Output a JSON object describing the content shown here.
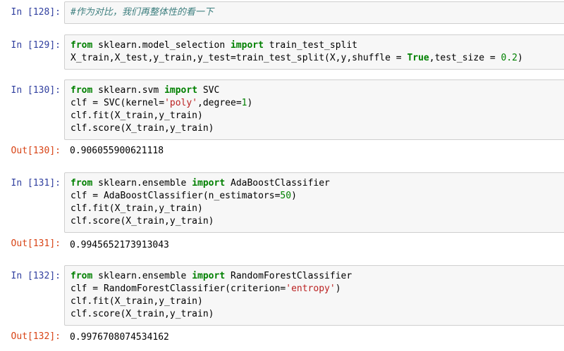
{
  "cells": [
    {
      "in_prompt": "In [128]:",
      "comment": "#作为对比，我们再整体性的看一下"
    },
    {
      "in_prompt": "In [129]:",
      "line1": {
        "kw1": "from",
        "mod": " sklearn.model_selection ",
        "kw2": "import",
        "name": " train_test_split"
      },
      "line2": {
        "pre": "X_train,X_test,y_train,y_test=train_test_split(X,y,shuffle = ",
        "kw": "True",
        "mid": ",test_size = ",
        "num": "0.2",
        "post": ")"
      }
    },
    {
      "in_prompt": "In [130]:",
      "line1": {
        "kw1": "from",
        "mod": " sklearn.svm ",
        "kw2": "import",
        "name": " SVC"
      },
      "line2": {
        "pre": "clf = SVC(kernel=",
        "str": "'poly'",
        "mid": ",degree=",
        "num": "1",
        "post": ")"
      },
      "line3": "clf.fit(X_train,y_train)",
      "line4": "clf.score(X_train,y_train)",
      "out_prompt": "Out[130]:",
      "output": "0.906055900621118"
    },
    {
      "in_prompt": "In [131]:",
      "line1": {
        "kw1": "from",
        "mod": " sklearn.ensemble ",
        "kw2": "import",
        "name": " AdaBoostClassifier"
      },
      "line2": {
        "pre": "clf = AdaBoostClassifier(n_estimators=",
        "num": "50",
        "post": ")"
      },
      "line3": "clf.fit(X_train,y_train)",
      "line4": "clf.score(X_train,y_train)",
      "out_prompt": "Out[131]:",
      "output": "0.9945652173913043"
    },
    {
      "in_prompt": "In [132]:",
      "line1": {
        "kw1": "from",
        "mod": " sklearn.ensemble ",
        "kw2": "import",
        "name": " RandomForestClassifier"
      },
      "line2": {
        "pre": "clf = RandomForestClassifier(criterion=",
        "str": "'entropy'",
        "post": ")"
      },
      "line3": "clf.fit(X_train,y_train)",
      "line4": "clf.score(X_train,y_train)",
      "out_prompt": "Out[132]:",
      "output": "0.9976708074534162"
    }
  ]
}
